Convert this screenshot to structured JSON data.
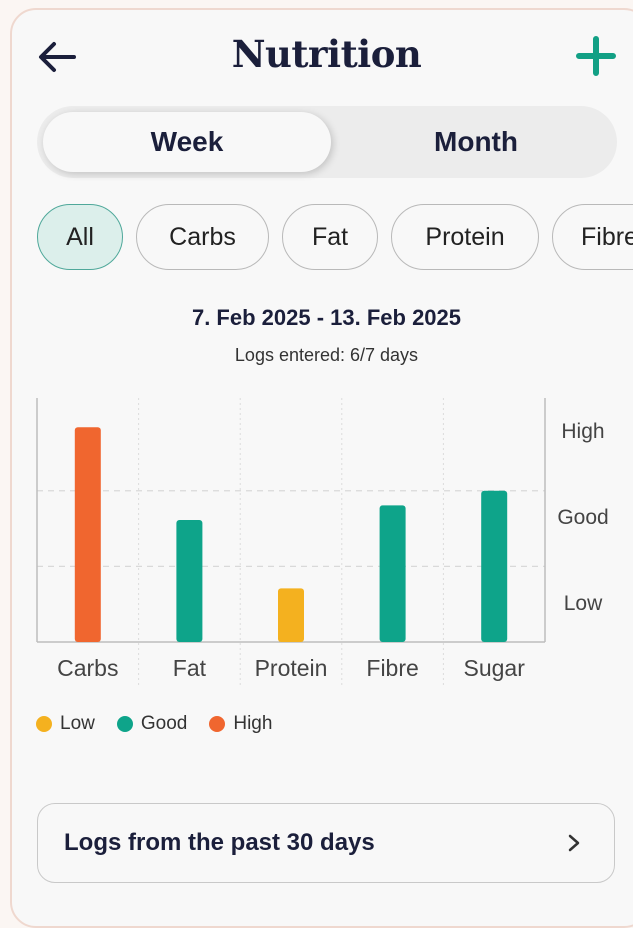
{
  "header": {
    "title": "Nutrition",
    "back_icon": "arrow-left-icon",
    "add_icon": "plus-icon",
    "accent_color": "#12a085"
  },
  "period_toggle": {
    "options": [
      "Week",
      "Month"
    ],
    "selected": "Week"
  },
  "filters": {
    "chips": [
      "All",
      "Carbs",
      "Fat",
      "Protein",
      "Fibre"
    ],
    "selected": "All"
  },
  "summary": {
    "date_range": "7. Feb 2025  - 13. Feb 2025",
    "logs_entered": "Logs entered: 6/7 days"
  },
  "chart_data": {
    "type": "bar",
    "categories": [
      "Carbs",
      "Fat",
      "Protein",
      "Fibre",
      "Sugar"
    ],
    "values": [
      0.88,
      0.5,
      0.22,
      0.56,
      0.62
    ],
    "status": [
      "High",
      "Good",
      "Low",
      "Good",
      "Good"
    ],
    "y_levels": [
      "High",
      "Good",
      "Low"
    ],
    "ylim": [
      0,
      1
    ],
    "grid": true,
    "status_colors": {
      "Low": "#f4b11f",
      "Good": "#0ea48a",
      "High": "#f0662f"
    }
  },
  "legend": [
    {
      "label": "Low",
      "color": "#f4b11f"
    },
    {
      "label": "Good",
      "color": "#0ea48a"
    },
    {
      "label": "High",
      "color": "#f0662f"
    }
  ],
  "logs_link": {
    "label": "Logs from the past 30 days",
    "chevron_icon": "chevron-right-icon"
  }
}
